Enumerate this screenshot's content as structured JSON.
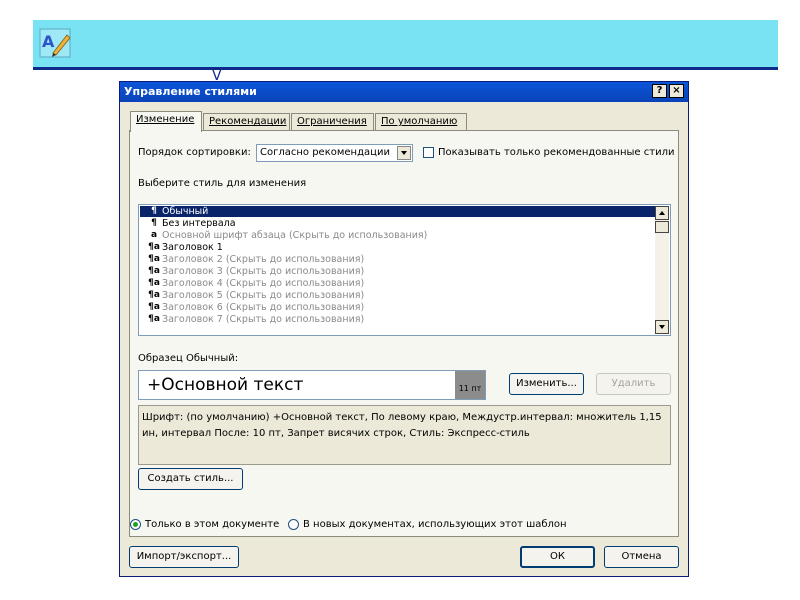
{
  "dialog": {
    "title": "Управление стилями",
    "help_btn": "?",
    "close_btn": "×"
  },
  "tabs": [
    {
      "label": "Изменение",
      "active": true
    },
    {
      "label": "Рекомендации",
      "active": false
    },
    {
      "label": "Ограничения",
      "active": false
    },
    {
      "label": "По умолчанию",
      "active": false
    }
  ],
  "sort": {
    "label": "Порядок сортировки:",
    "value": "Согласно рекомендации"
  },
  "only_recommended": {
    "label": "Показывать только рекомендованные стили",
    "checked": false
  },
  "style_list": {
    "label": "Выберите стиль для изменения",
    "items": [
      {
        "icon": "¶",
        "text": "Обычный",
        "selected": true
      },
      {
        "icon": "¶",
        "text": "Без интервала",
        "selected": false
      },
      {
        "icon": "a",
        "text": "Основной шрифт абзаца  (Скрыть до использования)",
        "selected": false
      },
      {
        "icon": "¶a",
        "text": "Заголовок 1",
        "selected": false
      },
      {
        "icon": "¶a",
        "text": "Заголовок 2  (Скрыть до использования)",
        "selected": false
      },
      {
        "icon": "¶a",
        "text": "Заголовок 3  (Скрыть до использования)",
        "selected": false
      },
      {
        "icon": "¶a",
        "text": "Заголовок 4  (Скрыть до использования)",
        "selected": false
      },
      {
        "icon": "¶a",
        "text": "Заголовок 5  (Скрыть до использования)",
        "selected": false
      },
      {
        "icon": "¶a",
        "text": "Заголовок 6  (Скрыть до использования)",
        "selected": false
      },
      {
        "icon": "¶a",
        "text": "Заголовок 7  (Скрыть до использования)",
        "selected": false
      }
    ]
  },
  "preview": {
    "label": "Образец Обычный:",
    "text": "+Основной текст",
    "size": "11 пт"
  },
  "buttons": {
    "modify": "Изменить...",
    "delete": "Удалить",
    "new_style": "Создать стиль...",
    "import_export": "Импорт/экспорт...",
    "ok": "ОК",
    "cancel": "Отмена"
  },
  "description": "Шрифт: (по умолчанию) +Основной текст, По левому краю, Междустр.интервал:  множитель 1,15 ин, интервал После:  10 пт, Запрет висячих строк, Стиль: Экспресс-стиль",
  "scope": {
    "this_doc": "Только в этом документе",
    "new_docs": "В новых документах, использующих этот шаблон",
    "selected": "this_doc"
  }
}
